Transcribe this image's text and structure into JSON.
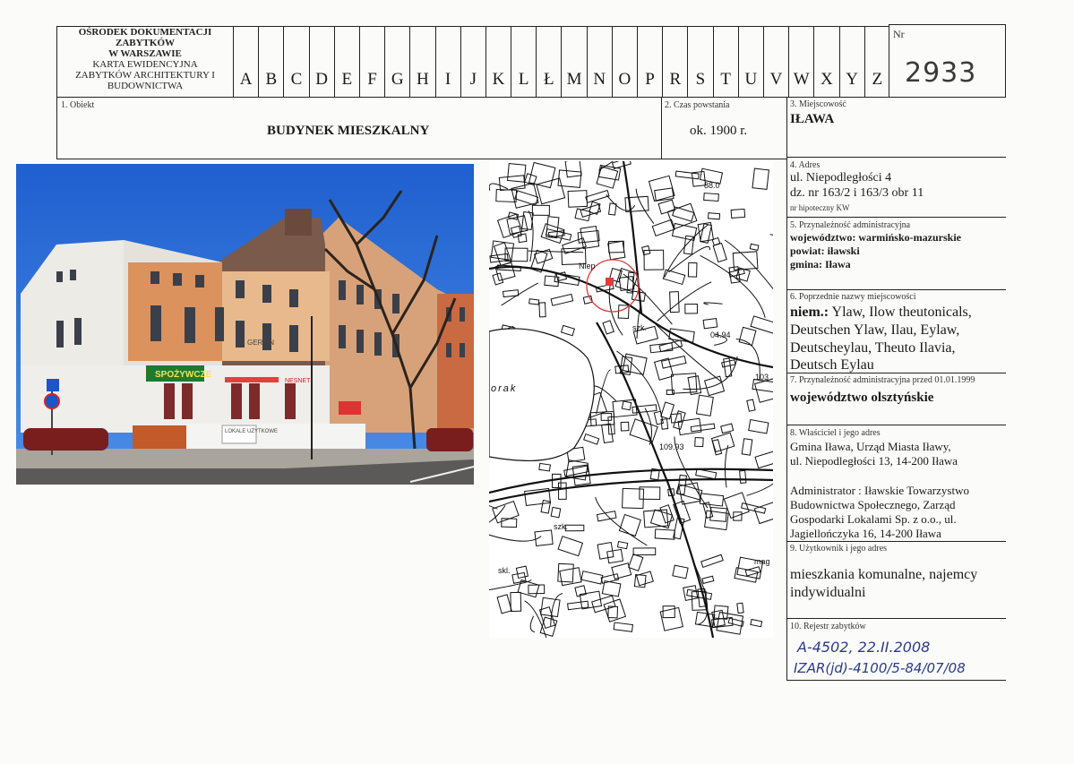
{
  "header": {
    "institution_lines": [
      "OŚRODEK DOKUMENTACJI",
      "ZABYTKÓW",
      "W WARSZAWIE",
      "KARTA EWIDENCYJNA",
      "ZABYTKÓW ARCHITEKTURY I",
      "BUDOWNICTWA"
    ],
    "letters": [
      "A",
      "B",
      "C",
      "D",
      "E",
      "F",
      "G",
      "H",
      "I",
      "J",
      "K",
      "L",
      "Ł",
      "M",
      "N",
      "O",
      "P",
      "R",
      "S",
      "T",
      "U",
      "V",
      "W",
      "X",
      "Y",
      "Z"
    ],
    "nr_label": "Nr",
    "nr_value": "2933"
  },
  "obiekt": {
    "label": "1. Obiekt",
    "value": "BUDYNEK MIESZKALNY"
  },
  "czas": {
    "label": "2. Czas powstania",
    "value": "ok. 1900 r."
  },
  "miejscowosc": {
    "label": "3. Miejscowość",
    "value": "IŁAWA"
  },
  "adres": {
    "label": "4. Adres",
    "line1": "ul. Niepodległości 4",
    "line2": "dz. nr  163/2 i 163/3 obr 11",
    "line3": "nr hipoteczny KW"
  },
  "przynaleznosc": {
    "label": "5. Przynależność administracyjna",
    "line1": "województwo: warmińsko-mazurskie",
    "line2": "powiat: iławski",
    "line3": "gmina: Iława"
  },
  "poprzednie_nazwy": {
    "label": "6. Poprzednie nazwy miejscowości",
    "prefix": "niem.:",
    "line1": " Ylaw, Ilow theutonicals,",
    "line2": "Deutschen Ylaw, Ilau, Eylaw,",
    "line3": "Deutscheylau, Theuto Ilavia,",
    "line4": "Deutsch Eylau"
  },
  "przynaleznosc_1999": {
    "label": "7. Przynależność administracyjna  przed 01.01.1999",
    "value": "województwo  olsztyńskie"
  },
  "wlasciciel": {
    "label": "8. Właściciel i jego adres",
    "line1": "Gmina Iława, Urząd Miasta Iławy,",
    "line2": "ul. Niepodległości 13, 14-200 Iława",
    "line3": "Administrator : Iławskie Towarzystwo",
    "line4": "Budownictwa Społecznego, Zarząd",
    "line5": "Gospodarki Lokalami Sp. z o.o., ul.",
    "line6": "Jagiellończyka 16, 14-200 Iława"
  },
  "uzytkownik": {
    "label": "9. Użytkownik i jego adres",
    "line1": "mieszkania komunalne, najemcy",
    "line2": "indywidualni"
  },
  "rejestr": {
    "label": "10. Rejestr zabytków",
    "line1": "A-4502, 22.II.2008",
    "line2": "IZAR(jd)-4100/5-84/07/08"
  },
  "photo_signs": {
    "shop": "SPOŻYWCZE",
    "shop2": "LOKALE  UŻYTKOWE",
    "net": "NESNET",
    "gertin": "GERTIN"
  },
  "map_labels": {
    "street": "Niep",
    "lake": "orak",
    "elev1": "04.94",
    "elev2": "109.93",
    "szk1": "szk.",
    "szk2": "szk.",
    "skl": "skl.",
    "mag": "mag",
    "num103": "103",
    "num88": "88.0"
  },
  "colors": {
    "sky": "#2a6fd1",
    "facade_white": "#ecebe6",
    "facade_orange": "#d9894f",
    "map_circle": "#e23b3b",
    "ink_blue": "#2b3a8a"
  }
}
